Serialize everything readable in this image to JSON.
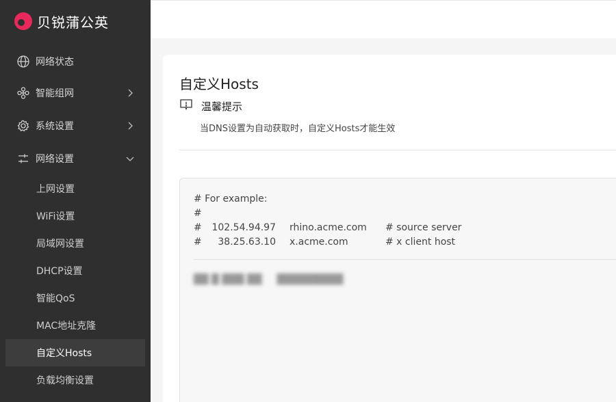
{
  "brand": {
    "name": "贝锐蒲公英",
    "logo_color": "#e8295b"
  },
  "sidebar": {
    "menu": [
      {
        "label": "网络状态",
        "icon": "globe-icon",
        "chevron": ""
      },
      {
        "label": "智能组网",
        "icon": "network-nodes-icon",
        "chevron": "right"
      },
      {
        "label": "系统设置",
        "icon": "gear-icon",
        "chevron": "right"
      },
      {
        "label": "网络设置",
        "icon": "sliders-icon",
        "chevron": "down"
      }
    ],
    "submenu": [
      {
        "label": "上网设置"
      },
      {
        "label": "WiFi设置"
      },
      {
        "label": "局域网设置"
      },
      {
        "label": "DHCP设置"
      },
      {
        "label": "智能QoS"
      },
      {
        "label": "MAC地址克隆"
      },
      {
        "label": "自定义Hosts",
        "active": true
      },
      {
        "label": "负载均衡设置"
      }
    ]
  },
  "main": {
    "title": "自定义Hosts",
    "tip": {
      "title": "温馨提示",
      "icon": "info-message-icon",
      "text": "当DNS设置为自动获取时，自定义Hosts才能生效"
    },
    "editor": {
      "example_header": "# For example:",
      "example_blank": "#",
      "examples": [
        {
          "hash": "#",
          "ip": "102.54.94.97",
          "host": "rhino.acme.com",
          "comment": "# source server"
        },
        {
          "hash": "#",
          "ip": "38.25.63.10",
          "host": "x.acme.com",
          "comment": "# x client host"
        }
      ]
    }
  }
}
